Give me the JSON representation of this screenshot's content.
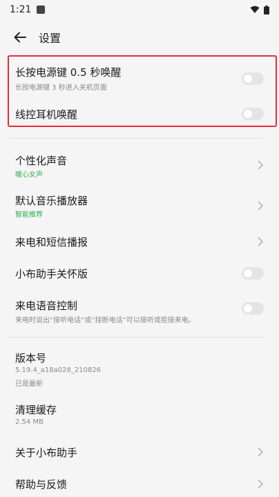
{
  "status_bar": {
    "time": "1:21"
  },
  "header": {
    "title": "设置"
  },
  "wake_group": {
    "long_press": {
      "title": "长按电源键 0.5 秒唤醒",
      "subtitle": "长按电源键 3 秒进入关机页面",
      "enabled": false
    },
    "earphone": {
      "title": "线控耳机唤醒",
      "enabled": false
    }
  },
  "settings_group": {
    "voice": {
      "title": "个性化声音",
      "subtitle": "暖心女声"
    },
    "music_player": {
      "title": "默认音乐播放器",
      "subtitle": "智能推荐"
    },
    "call_sms": {
      "title": "来电和短信播报"
    },
    "care_mode": {
      "title": "小布助手关怀版",
      "enabled": false
    },
    "call_voice": {
      "title": "来电语音控制",
      "subtitle": "来电时说出“接听电话”或“挂断电话”可以接听或拒接来电。",
      "enabled": false
    }
  },
  "info_group": {
    "version": {
      "title": "版本号",
      "value": "5.19.4_a18a028_210826",
      "status": "已是最新"
    },
    "cache": {
      "title": "清理缓存",
      "value": "2.54 MB"
    },
    "about": {
      "title": "关于小布助手"
    },
    "help": {
      "title": "帮助与反馈"
    }
  },
  "colors": {
    "highlight": "#e8293a",
    "accent_green": "#33b153"
  }
}
